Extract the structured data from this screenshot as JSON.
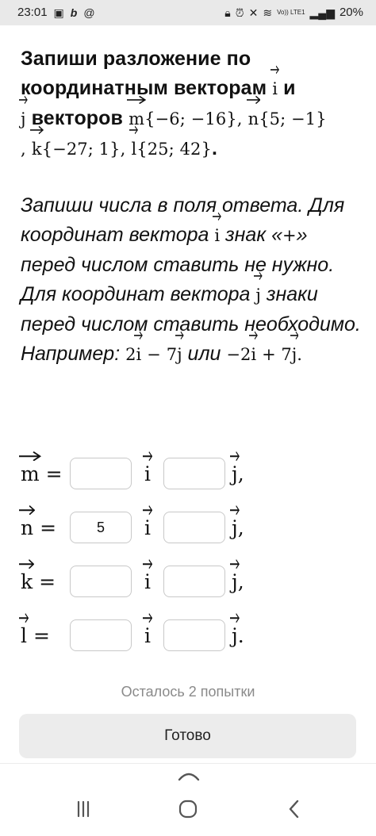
{
  "status_bar": {
    "time": "23:01",
    "left_icons": [
      "photo-icon",
      "b-app-icon",
      "at-icon"
    ],
    "right_icons": [
      "lock-icon",
      "alarm-icon",
      "mute-icon",
      "wifi-icon",
      "signal-icon"
    ],
    "volte": "Vo)) LTE1",
    "battery": "20%"
  },
  "task": {
    "title_part1": "Запиши разложение по координатным векторам",
    "and": "и",
    "vectors_word": "векторов",
    "vec_i": "i",
    "vec_j": "j",
    "vec_m": "m",
    "vec_n": "n",
    "vec_k": "k",
    "vec_l": "l",
    "m_coords": "{−6; −16},",
    "n_coords": "{5; −1}",
    "comma": ",",
    "k_coords": "{−27; 1},",
    "l_coords": "{25; 42}",
    "dot": ".",
    "instr_1": "Запиши числа в поля ответа. Для координат вектора",
    "instr_2": "знак «",
    "plus": "+",
    "instr_3": "» перед числом ставить не нужно. Для координат вектора",
    "instr_4": "знаки перед числом ставить необходимо. Например:",
    "ex1_a": "2",
    "minus": "−",
    "ex1_b": "7",
    "or": "или",
    "ex2_a": "−2",
    "ex2_b": "+ 7",
    "ex_end": "."
  },
  "equations": [
    {
      "vec": "m",
      "eq": "=",
      "i_value": "",
      "j_value": "",
      "end": ","
    },
    {
      "vec": "n",
      "eq": "=",
      "i_value": "5",
      "j_value": "",
      "end": ","
    },
    {
      "vec": "k",
      "eq": "=",
      "i_value": "",
      "j_value": "",
      "end": ","
    },
    {
      "vec": "l",
      "eq": "=",
      "i_value": "",
      "j_value": "",
      "end": "."
    }
  ],
  "attempts_text": "Осталось 2 попытки",
  "done_label": "Готово",
  "nav": [
    "recent-apps-icon",
    "home-icon",
    "back-icon"
  ]
}
